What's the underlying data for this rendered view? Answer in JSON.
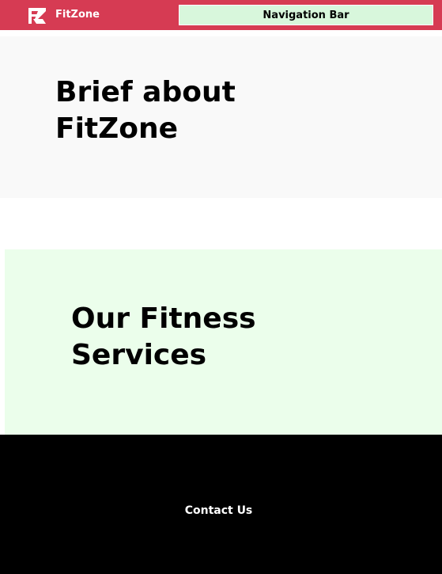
{
  "header": {
    "brand": "FitZone",
    "logo_icon": "fz-logo-icon",
    "nav_label": "Navigation Bar"
  },
  "brief": {
    "title": "Brief about FitZone"
  },
  "services": {
    "title": "Our Fitness Services"
  },
  "footer": {
    "contact": "Contact Us"
  },
  "colors": {
    "header_bg": "#d63b53",
    "nav_bg": "#d8f7dc",
    "brief_bg": "#f9f9f9",
    "services_bg": "#ebfeeb",
    "footer_bg": "#000000"
  }
}
